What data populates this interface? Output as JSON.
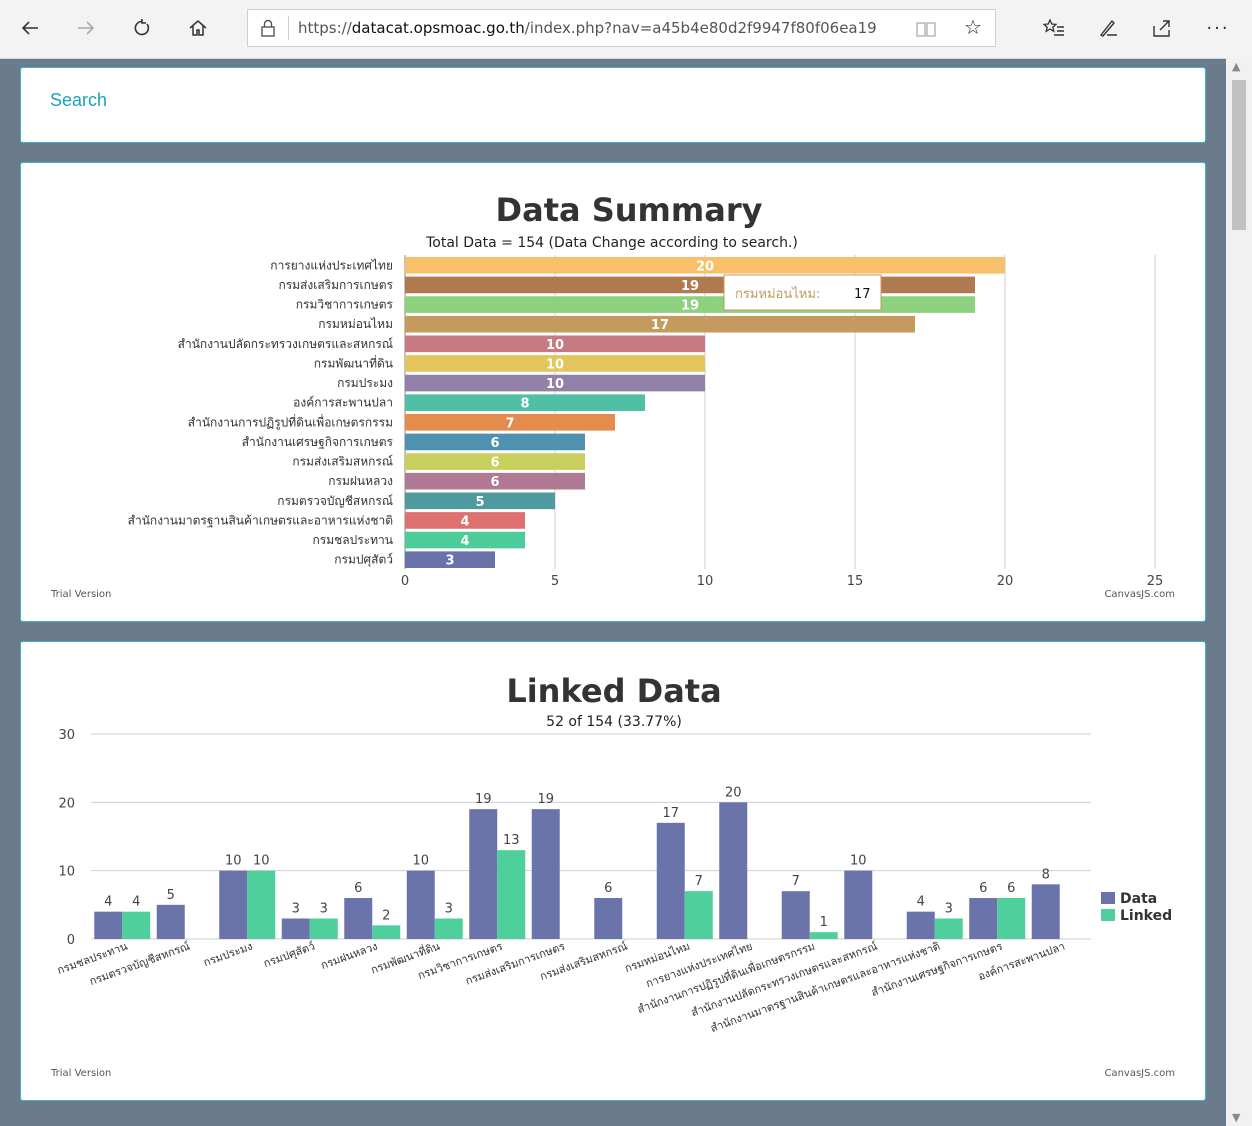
{
  "browser": {
    "url_host": "datacat.opsmoac.go.th",
    "url_prefix": "https://",
    "url_rest": "/index.php?nav=a45b4e80d2f9947f80f06ea19"
  },
  "search": {
    "label": "Search"
  },
  "summary_chart": {
    "title": "Data Summary",
    "subtitle": "Total Data = 154 (Data Change according to search.)",
    "footer_left": "Trial Version",
    "footer_right": "CanvasJS.com",
    "tooltip": {
      "label": "กรมหม่อนไหม:",
      "value": "17"
    }
  },
  "linked_chart": {
    "title": "Linked Data",
    "subtitle": "52 of 154 (33.77%)",
    "footer_left": "Trial Version",
    "footer_right": "CanvasJS.com"
  },
  "chart_data": [
    {
      "type": "bar",
      "orientation": "horizontal",
      "title": "Data Summary",
      "subtitle": "Total Data = 154 (Data Change according to search.)",
      "xlim": [
        0,
        25
      ],
      "ticks": [
        0,
        5,
        10,
        15,
        20,
        25
      ],
      "grid": true,
      "categories": [
        "การยางแห่งประเทศไทย",
        "กรมส่งเสริมการเกษตร",
        "กรมวิชาการเกษตร",
        "กรมหม่อนไหม",
        "สำนักงานปลัดกระทรวงเกษตรและสหกรณ์",
        "กรมพัฒนาที่ดิน",
        "กรมประมง",
        "องค์การสะพานปลา",
        "สำนักงานการปฏิรูปที่ดินเพื่อเกษตรกรรม",
        "สำนักงานเศรษฐกิจการเกษตร",
        "กรมส่งเสริมสหกรณ์",
        "กรมฝนหลวง",
        "กรมตรวจบัญชีสหกรณ์",
        "สำนักงานมาตรฐานสินค้าเกษตรและอาหารแห่งชาติ",
        "กรมชลประทาน",
        "กรมปศุสัตว์"
      ],
      "values": [
        20,
        19,
        19,
        17,
        10,
        10,
        10,
        8,
        7,
        6,
        6,
        6,
        5,
        4,
        4,
        3
      ],
      "colors": [
        "#f9c06b",
        "#b07a50",
        "#8dd07e",
        "#c49a5e",
        "#c67a82",
        "#e2c65c",
        "#9180a8",
        "#4fbfa5",
        "#e58c4c",
        "#5191b0",
        "#c9cf5d",
        "#b17a94",
        "#4f9a9e",
        "#de7070",
        "#4ccb9b",
        "#6a72aa"
      ]
    },
    {
      "type": "bar",
      "title": "Linked Data",
      "subtitle": "52 of 154 (33.77%)",
      "ylim": [
        0,
        30
      ],
      "ticks": [
        0,
        10,
        20,
        30
      ],
      "grid": true,
      "legend": "right",
      "categories": [
        "กรมชลประทาน",
        "กรมตรวจบัญชีสหกรณ์",
        "กรมประมง",
        "กรมปศุสัตว์",
        "กรมฝนหลวง",
        "กรมพัฒนาที่ดิน",
        "กรมวิชาการเกษตร",
        "กรมส่งเสริมการเกษตร",
        "กรมส่งเสริมสหกรณ์",
        "กรมหม่อนไหม",
        "การยางแห่งประเทศไทย",
        "สำนักงานการปฏิรูปที่ดินเพื่อเกษตรกรรม",
        "สำนักงานปลัดกระทรวงเกษตรและสหกรณ์",
        "สำนักงานมาตรฐานสินค้าเกษตรและอาหารแห่งชาติ",
        "สำนักงานเศรษฐกิจการเกษตร",
        "องค์การสะพานปลา"
      ],
      "series": [
        {
          "name": "Data",
          "color": "#6b74aa",
          "values": [
            4,
            5,
            10,
            3,
            6,
            10,
            19,
            19,
            6,
            17,
            20,
            7,
            10,
            4,
            6,
            8
          ]
        },
        {
          "name": "Linked",
          "color": "#4fcf9c",
          "values": [
            4,
            null,
            10,
            3,
            2,
            3,
            13,
            null,
            null,
            7,
            null,
            1,
            null,
            3,
            6,
            null
          ]
        }
      ]
    }
  ]
}
